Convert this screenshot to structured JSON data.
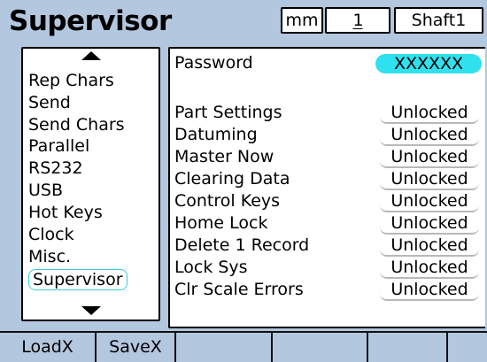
{
  "header": {
    "title": "Supervisor",
    "units": "mm",
    "channel": "1",
    "part": "Shaft1"
  },
  "menu": {
    "items": [
      {
        "label": "Rep Chars"
      },
      {
        "label": "Send"
      },
      {
        "label": "Send Chars"
      },
      {
        "label": "Parallel"
      },
      {
        "label": "RS232"
      },
      {
        "label": "USB"
      },
      {
        "label": "Hot Keys"
      },
      {
        "label": "Clock"
      },
      {
        "label": "Misc."
      },
      {
        "label": "Supervisor"
      }
    ],
    "selected": "Supervisor"
  },
  "settings": {
    "password_label": "Password",
    "password_value": "XXXXXX",
    "rows": [
      {
        "label": "Part Settings",
        "value": "Unlocked"
      },
      {
        "label": "Datuming",
        "value": "Unlocked"
      },
      {
        "label": "Master Now",
        "value": "Unlocked"
      },
      {
        "label": "Clearing Data",
        "value": "Unlocked"
      },
      {
        "label": "Control Keys",
        "value": "Unlocked"
      },
      {
        "label": "Home Lock",
        "value": "Unlocked"
      },
      {
        "label": "Delete 1 Record",
        "value": "Unlocked"
      },
      {
        "label": "Lock Sys",
        "value": "Unlocked"
      },
      {
        "label": "Clr Scale Errors",
        "value": "Unlocked"
      }
    ]
  },
  "softkeys": [
    "LoadX",
    "SaveX",
    "",
    "",
    "",
    ""
  ],
  "colors": {
    "background": "#b3c7de",
    "highlight": "#2fe0ef",
    "panel": "#ffffff"
  }
}
